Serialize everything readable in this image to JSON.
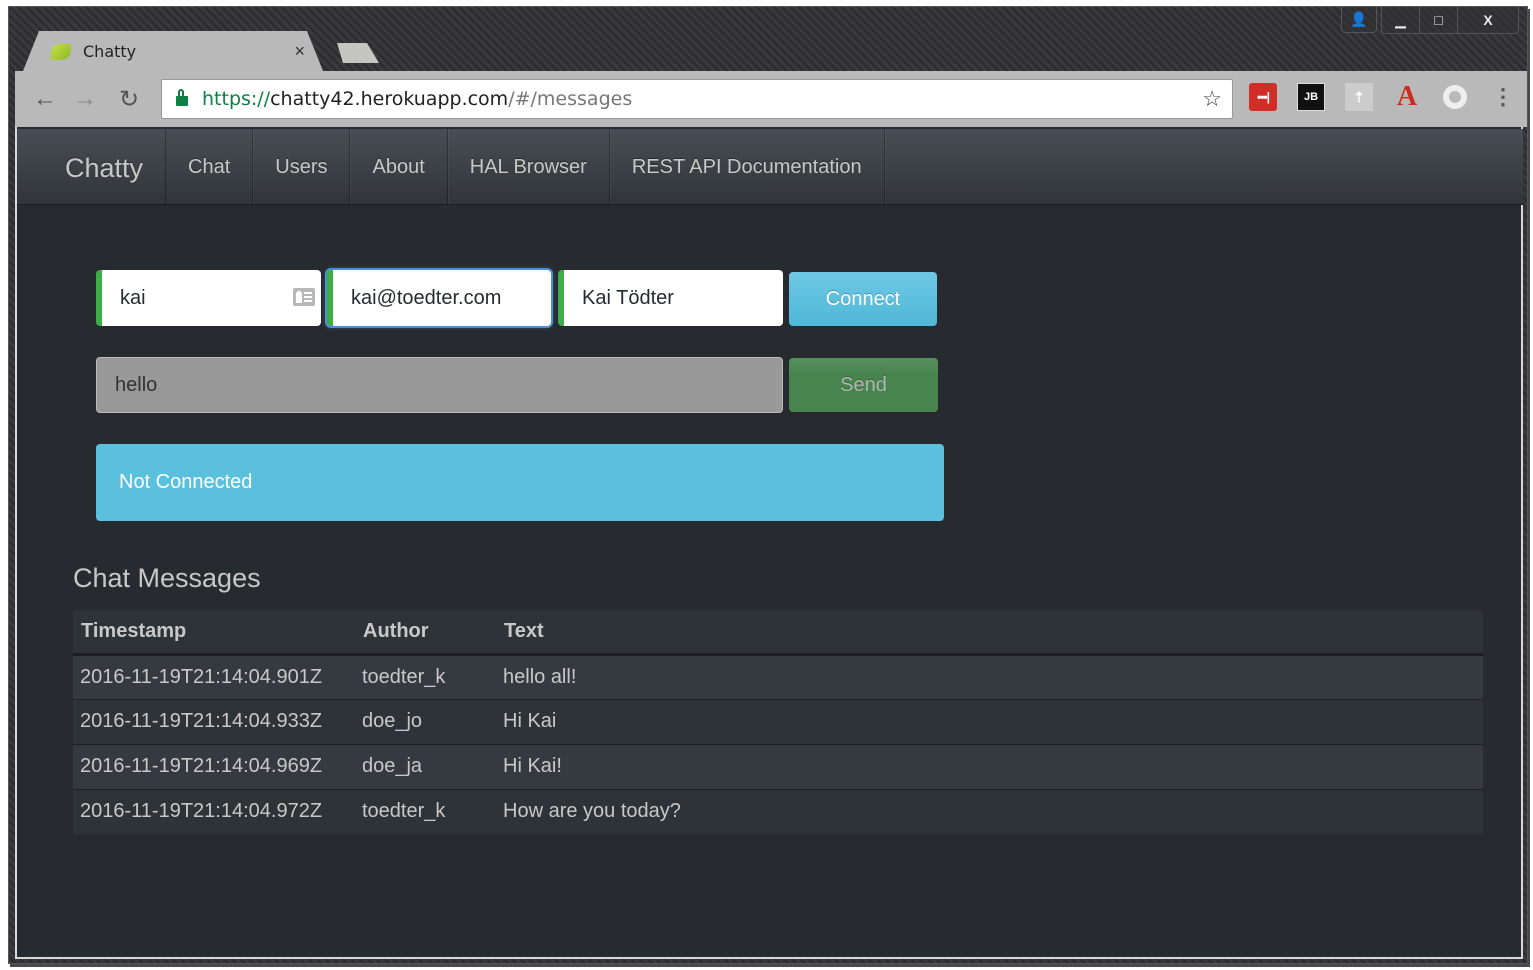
{
  "browser": {
    "tab_title": "Chatty",
    "tab_close": "×",
    "url_scheme": "https://",
    "url_host": "chatty42.herokuapp.com",
    "url_path": "/#/messages",
    "icons": {
      "back": "←",
      "forward": "→",
      "reload": "↻",
      "bookmark": "☆",
      "lastpass": "•••|",
      "jetbrains": "JB",
      "upload": "⇡",
      "adobe": "A",
      "menu": "⋮",
      "profile": "👤",
      "minimize": "▁",
      "maximize": "□",
      "close": "X"
    }
  },
  "navbar": {
    "brand": "Chatty",
    "items": [
      {
        "label": "Chat"
      },
      {
        "label": "Users"
      },
      {
        "label": "About"
      },
      {
        "label": "HAL Browser"
      },
      {
        "label": "REST API Documentation"
      }
    ]
  },
  "form": {
    "username": "kai",
    "email": "kai@toedter.com",
    "fullname": "Kai Tödter",
    "connect_label": "Connect",
    "message": "hello",
    "send_label": "Send",
    "status": "Not Connected"
  },
  "colors": {
    "accent_info": "#5bc0de",
    "success": "#3fad46",
    "background": "#272b30"
  },
  "messages": {
    "title": "Chat Messages",
    "columns": [
      "Timestamp",
      "Author",
      "Text"
    ],
    "rows": [
      {
        "timestamp": "2016-11-19T21:14:04.901Z",
        "author": "toedter_k",
        "text": "hello all!"
      },
      {
        "timestamp": "2016-11-19T21:14:04.933Z",
        "author": "doe_jo",
        "text": "Hi Kai"
      },
      {
        "timestamp": "2016-11-19T21:14:04.969Z",
        "author": "doe_ja",
        "text": "Hi Kai!"
      },
      {
        "timestamp": "2016-11-19T21:14:04.972Z",
        "author": "toedter_k",
        "text": "How are you today?"
      }
    ]
  }
}
